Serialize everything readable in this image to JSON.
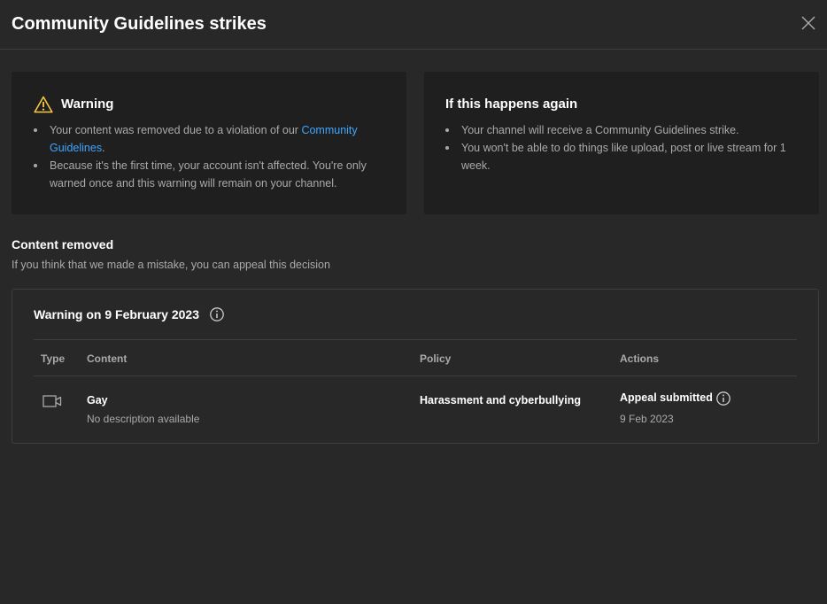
{
  "dialog": {
    "title": "Community Guidelines strikes",
    "close_icon": "close-icon"
  },
  "warning_card": {
    "icon": "warning-triangle-icon",
    "accent_color": "#f9c846",
    "heading": "Warning",
    "bullet1_before": "Your content was removed due to a violation of our ",
    "bullet1_link": "Community Guidelines",
    "bullet1_after": ".",
    "bullet2": "Because it's the first time, your account isn't affected. You're only warned once and this warning will remain on your channel."
  },
  "again_card": {
    "heading": "If this happens again",
    "bullets": [
      "Your channel will receive a Community Guidelines strike.",
      "You won't be able to do things like upload, post or live stream for 1 week."
    ]
  },
  "content_removed": {
    "title": "Content removed",
    "subtitle": "If you think that we made a mistake, you can appeal this decision"
  },
  "warning_table": {
    "title": "Warning on 9 February 2023",
    "info_icon": "info-icon",
    "columns": [
      "Type",
      "Content",
      "Policy",
      "Actions"
    ],
    "rows": [
      {
        "type_icon": "video-camera-icon",
        "content_title": "Gay",
        "content_description": "No description available",
        "policy": "Harassment and cyberbullying",
        "action_status": "Appeal submitted",
        "action_date": "9 Feb 2023"
      }
    ]
  },
  "colors": {
    "background": "#282828",
    "card": "#1f1f1f",
    "text_primary": "#ffffff",
    "text_secondary": "#aaaaaa",
    "link": "#3ea6ff",
    "divider": "#3e3e3e"
  }
}
